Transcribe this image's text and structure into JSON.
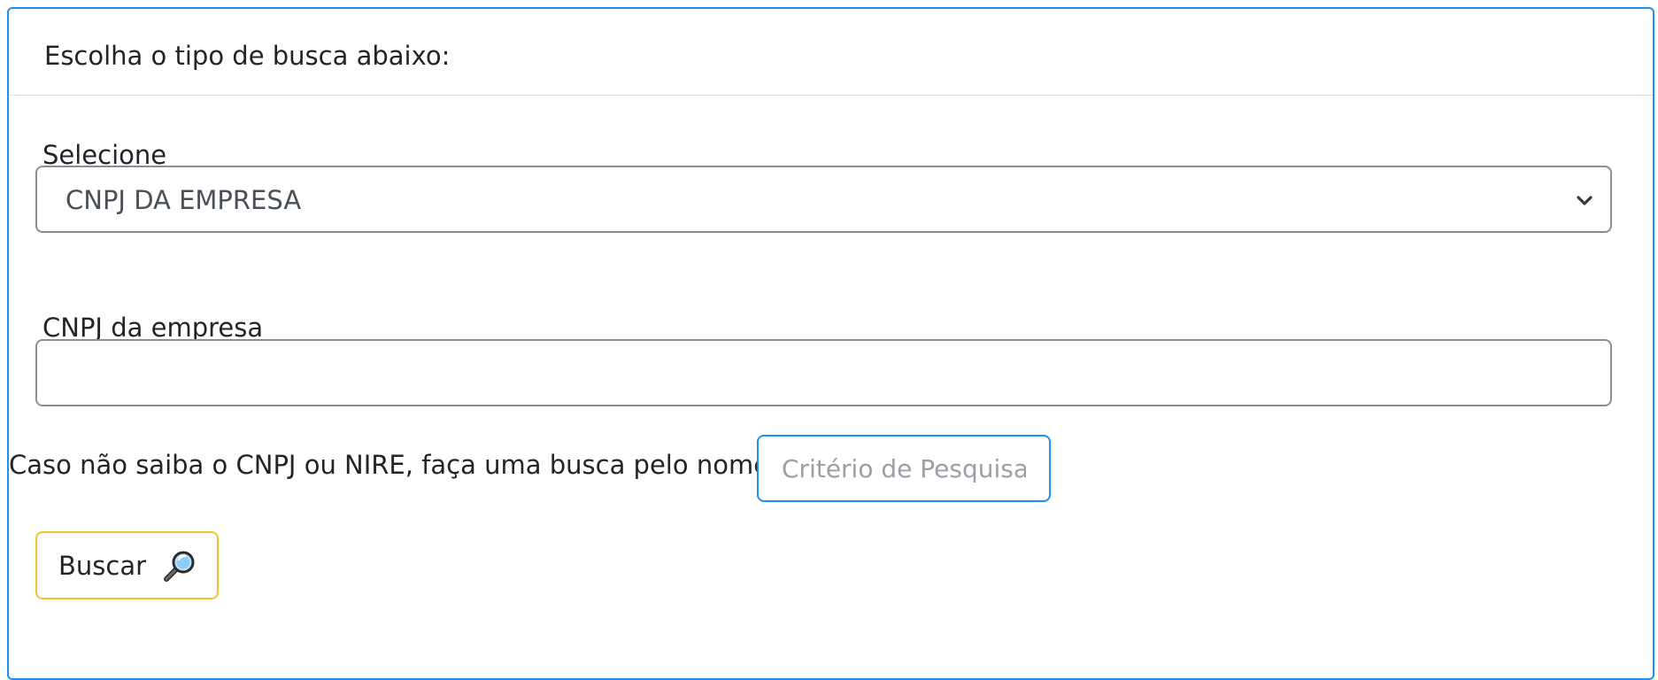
{
  "header": {
    "title": "Escolha o tipo de busca abaixo:"
  },
  "form": {
    "select_label": "Selecione",
    "select_value": "CNPJ DA EMPRESA",
    "cnpj_label": "CNPJ da empresa",
    "cnpj_value": "",
    "hint_text": "Caso não saiba o CNPJ ou NIRE, faça uma busca pelo nome",
    "criteria_placeholder": "Critério de Pesquisa",
    "search_button_label": "Buscar"
  },
  "icons": {
    "select_arrow": "chevron-down-icon",
    "search_button": "magnifying-glass-icon"
  },
  "colors": {
    "card_border": "#1f8ff0",
    "criteria_border": "#1f8ff0",
    "button_border": "#f4c430",
    "input_border": "#8a8f95"
  }
}
